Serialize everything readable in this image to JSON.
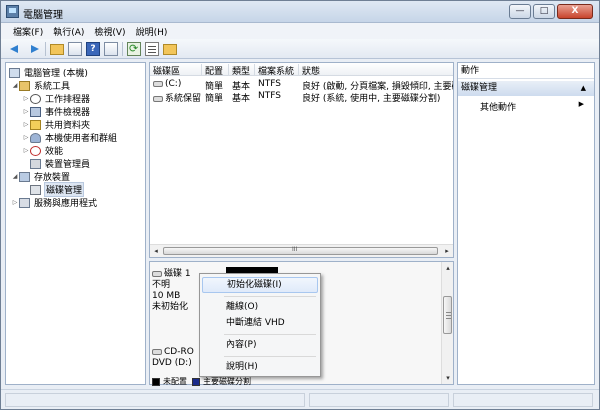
{
  "window": {
    "title": "電腦管理",
    "minimize_glyph": "—",
    "maximize_glyph": "□",
    "close_glyph": "X"
  },
  "menubar": [
    {
      "label": "檔案(F)"
    },
    {
      "label": "執行(A)"
    },
    {
      "label": "檢視(V)"
    },
    {
      "label": "說明(H)"
    }
  ],
  "toolbar": {
    "help_glyph": "?"
  },
  "tree": {
    "root": "電腦管理 (本機)",
    "system_tools": "系統工具",
    "task_scheduler": "工作排程器",
    "event_viewer": "事件檢視器",
    "shared_folders": "共用資料夾",
    "local_users": "本機使用者和群組",
    "performance": "效能",
    "device_manager": "裝置管理員",
    "storage": "存放裝置",
    "disk_management": "磁碟管理",
    "services": "服務與應用程式",
    "expanded_glyph": "◢",
    "collapsed_glyph": "▷"
  },
  "volume_table": {
    "columns": [
      "磁碟區",
      "配置",
      "類型",
      "檔案系統",
      "狀態"
    ],
    "rows": [
      {
        "volume": "(C:)",
        "layout": "簡單",
        "type": "基本",
        "fs": "NTFS",
        "status": "良好 (啟動, 分頁檔案, 損毀傾印, 主要磁"
      },
      {
        "volume": "系統保留",
        "layout": "簡單",
        "type": "基本",
        "fs": "NTFS",
        "status": "良好 (系統, 使用中, 主要磁碟分割)"
      }
    ],
    "scroll_left": "◂",
    "scroll_right": "▸",
    "scroll_grip": "III"
  },
  "disks": [
    {
      "name": "磁碟 1",
      "state": "不明",
      "size": "10 MB",
      "init": "未初始化"
    },
    {
      "name": "CD-RO",
      "drive": "DVD (D:)"
    }
  ],
  "disk_scroll": {
    "up": "▴",
    "down": "▾"
  },
  "legend": [
    {
      "label": "未配置",
      "color": "#000000"
    },
    {
      "label": "主要磁碟分割",
      "color": "#1a2b8a"
    }
  ],
  "context_menu": {
    "items": [
      {
        "label": "初始化磁碟(I)"
      },
      {
        "label": "離線(O)"
      },
      {
        "label": "中斷連結 VHD"
      },
      {
        "label": "內容(P)"
      },
      {
        "label": "說明(H)"
      }
    ]
  },
  "actions": {
    "header": "動作",
    "section": "磁碟管理",
    "collapse_glyph": "▲",
    "more_actions": "其他動作",
    "more_arrow": "▶"
  }
}
